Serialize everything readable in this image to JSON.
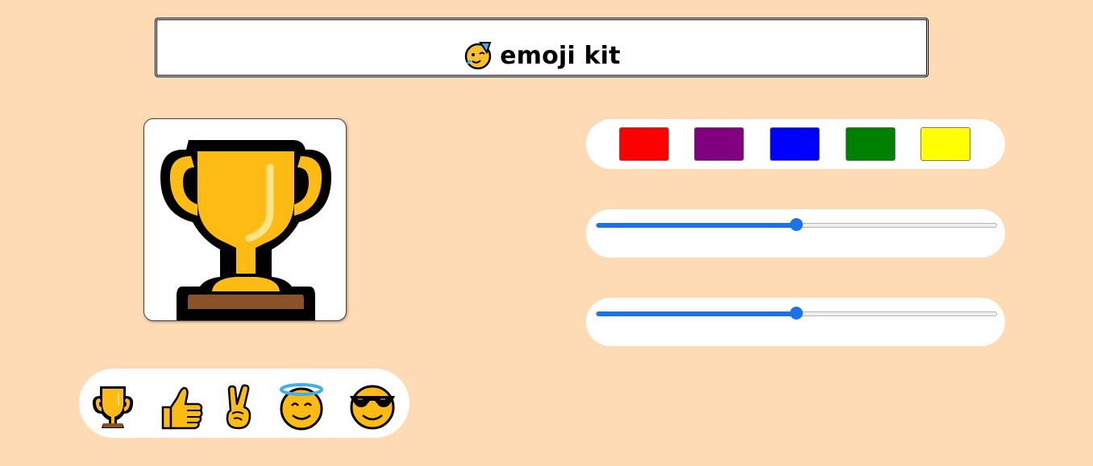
{
  "header": {
    "title": "emoji kit",
    "icon": "party-face-icon"
  },
  "preview": {
    "emoji": "trophy-icon"
  },
  "emoji_picker": {
    "items": [
      {
        "name": "trophy-icon"
      },
      {
        "name": "thumbs-up-icon"
      },
      {
        "name": "victory-hand-icon"
      },
      {
        "name": "halo-smiley-icon"
      },
      {
        "name": "sunglasses-smiley-icon"
      }
    ]
  },
  "color_picker": {
    "swatches": [
      "#ff0000",
      "#800080",
      "#0000ff",
      "#008000",
      "#ffff00"
    ]
  },
  "sliders": [
    {
      "value": 0.5,
      "accent": "#1a73e8"
    },
    {
      "value": 0.5,
      "accent": "#1a73e8"
    }
  ]
}
